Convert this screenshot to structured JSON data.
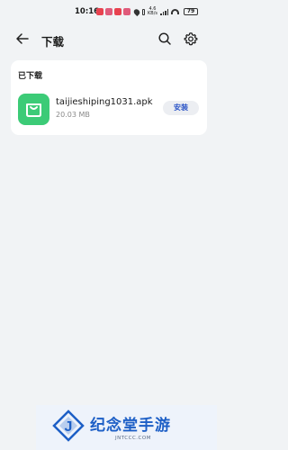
{
  "status_bar": {
    "time": "10:16",
    "network": "4.6\nKB/s",
    "battery": "79"
  },
  "header": {
    "title": "下载",
    "back_icon": "arrow-left-icon",
    "search_icon": "search-icon",
    "settings_icon": "gear-icon"
  },
  "downloads": {
    "section_title": "已下载",
    "items": [
      {
        "name": "taijieshiping1031.apk",
        "size": "20.03 MB",
        "action_label": "安装",
        "icon": "shopping-bag-icon"
      }
    ]
  },
  "watermark": {
    "name": "纪念堂手游",
    "domain": "JNTCCC.COM"
  },
  "colors": {
    "background": "#f1f3f5",
    "app_icon": "#3ccb77",
    "install_text": "#2c55c7",
    "watermark_brand": "#1d5fc6"
  }
}
